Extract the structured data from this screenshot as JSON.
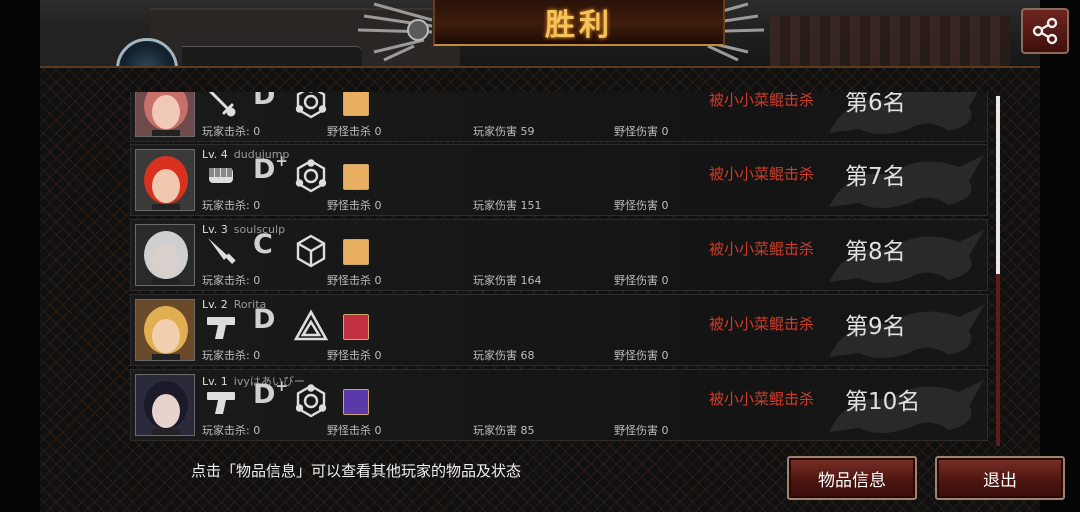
{
  "title": "胜利",
  "share_icon": "share-icon",
  "players": [
    {
      "level": "",
      "name": "",
      "weapon": "sword",
      "grade": "D",
      "grade_plus": "",
      "class_icon": "hex-cycle",
      "item_color": "#e8b060",
      "player_kills_label": "玩家击杀:",
      "player_kills": "0",
      "monster_kills_label": "野怪击杀",
      "monster_kills": "0",
      "player_damage_label": "玩家伤害",
      "player_damage": "59",
      "monster_damage_label": "野怪伤害",
      "monster_damage": "0",
      "killed_by": "被小小菜鲲击杀",
      "rank": "第6名",
      "portrait_hair": "#c8706a",
      "portrait_skin": "#f0c8b8",
      "portrait_bg": "#6e4a4a"
    },
    {
      "level": "Lv. 4",
      "name": "dudujump",
      "weapon": "fist",
      "grade": "D",
      "grade_plus": "+",
      "class_icon": "hex-cycle",
      "item_color": "#e8b060",
      "player_kills_label": "玩家击杀:",
      "player_kills": "0",
      "monster_kills_label": "野怪击杀",
      "monster_kills": "0",
      "player_damage_label": "玩家伤害",
      "player_damage": "151",
      "monster_damage_label": "野怪伤害",
      "monster_damage": "0",
      "killed_by": "被小小菜鲲击杀",
      "rank": "第7名",
      "portrait_hair": "#d8321e",
      "portrait_skin": "#f0c8b0",
      "portrait_bg": "#3a3a3a"
    },
    {
      "level": "Lv. 3",
      "name": "soulsculp",
      "weapon": "knife",
      "grade": "C",
      "grade_plus": "",
      "class_icon": "cube",
      "item_color": "#e8b060",
      "player_kills_label": "玩家击杀:",
      "player_kills": "0",
      "monster_kills_label": "野怪击杀",
      "monster_kills": "0",
      "player_damage_label": "玩家伤害",
      "player_damage": "164",
      "monster_damage_label": "野怪伤害",
      "monster_damage": "0",
      "killed_by": "被小小菜鲲击杀",
      "rank": "第8名",
      "portrait_hair": "#cfcfcf",
      "portrait_skin": "#d8d0cc",
      "portrait_bg": "#2a2a2a"
    },
    {
      "level": "Lv. 2",
      "name": "Rorita",
      "weapon": "pistol",
      "grade": "D",
      "grade_plus": "",
      "class_icon": "triangle",
      "item_color": "#c03040",
      "player_kills_label": "玩家击杀:",
      "player_kills": "0",
      "monster_kills_label": "野怪击杀",
      "monster_kills": "0",
      "player_damage_label": "玩家伤害",
      "player_damage": "68",
      "monster_damage_label": "野怪伤害",
      "monster_damage": "0",
      "killed_by": "被小小菜鲲击杀",
      "rank": "第9名",
      "portrait_hair": "#e0b050",
      "portrait_skin": "#f2cfae",
      "portrait_bg": "#6a4a2a"
    },
    {
      "level": "Lv. 1",
      "name": "ivyはあいびー",
      "weapon": "pistol",
      "grade": "D",
      "grade_plus": "+",
      "class_icon": "hex-cycle",
      "item_color": "#5a3aa8",
      "player_kills_label": "玩家击杀:",
      "player_kills": "0",
      "monster_kills_label": "野怪击杀",
      "monster_kills": "0",
      "player_damage_label": "玩家伤害",
      "player_damage": "85",
      "monster_damage_label": "野怪伤害",
      "monster_damage": "0",
      "killed_by": "被小小菜鲲击杀",
      "rank": "第10名",
      "portrait_hair": "#1a1a2a",
      "portrait_skin": "#e8d2cc",
      "portrait_bg": "#2a2a3a"
    }
  ],
  "hint_text": "点击「物品信息」可以查看其他玩家的物品及状态",
  "buttons": {
    "items_label": "物品信息",
    "exit_label": "退出"
  },
  "colors": {
    "accent_gold": "#f4c45c",
    "killed_red": "#d23b2b",
    "button_red": "#5a1812"
  }
}
